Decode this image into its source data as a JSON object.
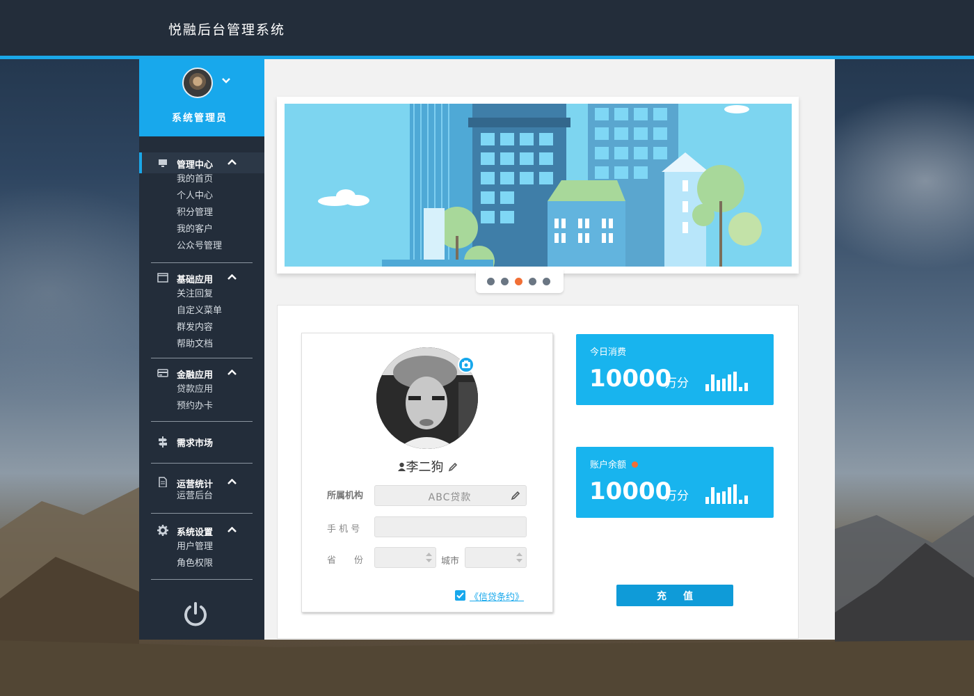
{
  "app": {
    "title": "悦融后台管理系统"
  },
  "colors": {
    "accent": "#18a8ec",
    "header_bg": "#232d3a",
    "alert_dot": "#f16f35"
  },
  "user": {
    "role": "系统管理员"
  },
  "nav": [
    {
      "icon": "monitor-icon",
      "label": "管理中心",
      "active": true,
      "items": [
        "我的首页",
        "个人中心",
        "积分管理",
        "我的客户",
        "公众号管理"
      ]
    },
    {
      "icon": "window-icon",
      "label": "基础应用",
      "items": [
        "关注回复",
        "自定义菜单",
        "群发内容",
        "帮助文档"
      ]
    },
    {
      "icon": "card-icon",
      "label": "金融应用",
      "items": [
        "贷款应用",
        "预约办卡"
      ]
    },
    {
      "icon": "signpost-icon",
      "label": "需求市场",
      "items": []
    },
    {
      "icon": "document-icon",
      "label": "运营统计",
      "items": [
        "运营后台"
      ]
    },
    {
      "icon": "gear-icon",
      "label": "系统设置",
      "items": [
        "用户管理",
        "角色权限"
      ]
    }
  ],
  "banner": {
    "slide_count": 5,
    "active_slide": 3
  },
  "profile": {
    "name": "李二狗",
    "org_label": "所属机构",
    "org_value": "ABC贷款",
    "phone_label": "手 机 号",
    "province_label": "省　　份",
    "city_label": "城市",
    "agreement_text": "《信贷条约》",
    "agreement_checked": true
  },
  "stats": [
    {
      "label": "今日消费",
      "value": "10000",
      "unit": "万分",
      "alert": false
    },
    {
      "label": "账户余额",
      "value": "10000",
      "unit": "万分",
      "alert": true
    }
  ],
  "actions": {
    "recharge_label": "充值"
  }
}
